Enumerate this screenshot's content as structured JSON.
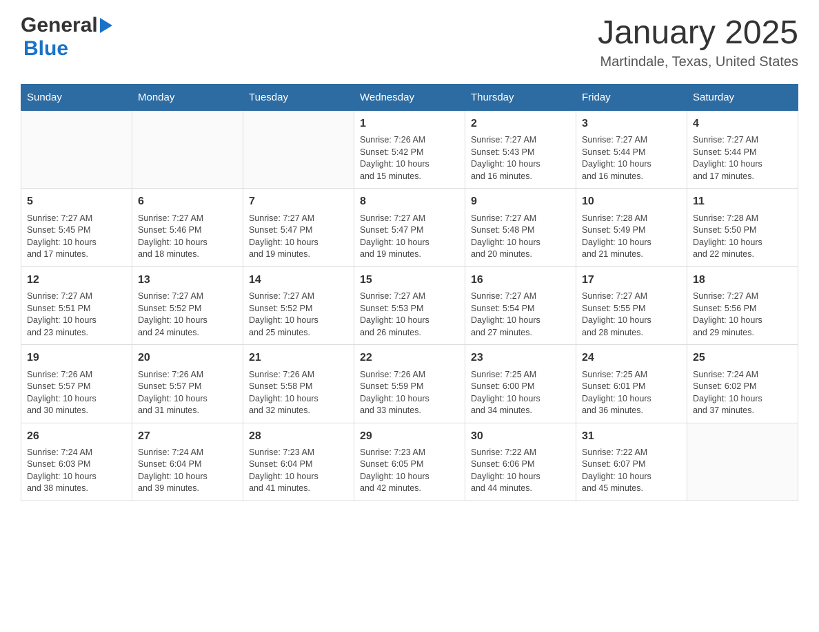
{
  "header": {
    "logo_general": "General",
    "logo_blue": "Blue",
    "title": "January 2025",
    "subtitle": "Martindale, Texas, United States"
  },
  "days_of_week": [
    "Sunday",
    "Monday",
    "Tuesday",
    "Wednesday",
    "Thursday",
    "Friday",
    "Saturday"
  ],
  "weeks": [
    [
      {
        "day": "",
        "info": ""
      },
      {
        "day": "",
        "info": ""
      },
      {
        "day": "",
        "info": ""
      },
      {
        "day": "1",
        "info": "Sunrise: 7:26 AM\nSunset: 5:42 PM\nDaylight: 10 hours\nand 15 minutes."
      },
      {
        "day": "2",
        "info": "Sunrise: 7:27 AM\nSunset: 5:43 PM\nDaylight: 10 hours\nand 16 minutes."
      },
      {
        "day": "3",
        "info": "Sunrise: 7:27 AM\nSunset: 5:44 PM\nDaylight: 10 hours\nand 16 minutes."
      },
      {
        "day": "4",
        "info": "Sunrise: 7:27 AM\nSunset: 5:44 PM\nDaylight: 10 hours\nand 17 minutes."
      }
    ],
    [
      {
        "day": "5",
        "info": "Sunrise: 7:27 AM\nSunset: 5:45 PM\nDaylight: 10 hours\nand 17 minutes."
      },
      {
        "day": "6",
        "info": "Sunrise: 7:27 AM\nSunset: 5:46 PM\nDaylight: 10 hours\nand 18 minutes."
      },
      {
        "day": "7",
        "info": "Sunrise: 7:27 AM\nSunset: 5:47 PM\nDaylight: 10 hours\nand 19 minutes."
      },
      {
        "day": "8",
        "info": "Sunrise: 7:27 AM\nSunset: 5:47 PM\nDaylight: 10 hours\nand 19 minutes."
      },
      {
        "day": "9",
        "info": "Sunrise: 7:27 AM\nSunset: 5:48 PM\nDaylight: 10 hours\nand 20 minutes."
      },
      {
        "day": "10",
        "info": "Sunrise: 7:28 AM\nSunset: 5:49 PM\nDaylight: 10 hours\nand 21 minutes."
      },
      {
        "day": "11",
        "info": "Sunrise: 7:28 AM\nSunset: 5:50 PM\nDaylight: 10 hours\nand 22 minutes."
      }
    ],
    [
      {
        "day": "12",
        "info": "Sunrise: 7:27 AM\nSunset: 5:51 PM\nDaylight: 10 hours\nand 23 minutes."
      },
      {
        "day": "13",
        "info": "Sunrise: 7:27 AM\nSunset: 5:52 PM\nDaylight: 10 hours\nand 24 minutes."
      },
      {
        "day": "14",
        "info": "Sunrise: 7:27 AM\nSunset: 5:52 PM\nDaylight: 10 hours\nand 25 minutes."
      },
      {
        "day": "15",
        "info": "Sunrise: 7:27 AM\nSunset: 5:53 PM\nDaylight: 10 hours\nand 26 minutes."
      },
      {
        "day": "16",
        "info": "Sunrise: 7:27 AM\nSunset: 5:54 PM\nDaylight: 10 hours\nand 27 minutes."
      },
      {
        "day": "17",
        "info": "Sunrise: 7:27 AM\nSunset: 5:55 PM\nDaylight: 10 hours\nand 28 minutes."
      },
      {
        "day": "18",
        "info": "Sunrise: 7:27 AM\nSunset: 5:56 PM\nDaylight: 10 hours\nand 29 minutes."
      }
    ],
    [
      {
        "day": "19",
        "info": "Sunrise: 7:26 AM\nSunset: 5:57 PM\nDaylight: 10 hours\nand 30 minutes."
      },
      {
        "day": "20",
        "info": "Sunrise: 7:26 AM\nSunset: 5:57 PM\nDaylight: 10 hours\nand 31 minutes."
      },
      {
        "day": "21",
        "info": "Sunrise: 7:26 AM\nSunset: 5:58 PM\nDaylight: 10 hours\nand 32 minutes."
      },
      {
        "day": "22",
        "info": "Sunrise: 7:26 AM\nSunset: 5:59 PM\nDaylight: 10 hours\nand 33 minutes."
      },
      {
        "day": "23",
        "info": "Sunrise: 7:25 AM\nSunset: 6:00 PM\nDaylight: 10 hours\nand 34 minutes."
      },
      {
        "day": "24",
        "info": "Sunrise: 7:25 AM\nSunset: 6:01 PM\nDaylight: 10 hours\nand 36 minutes."
      },
      {
        "day": "25",
        "info": "Sunrise: 7:24 AM\nSunset: 6:02 PM\nDaylight: 10 hours\nand 37 minutes."
      }
    ],
    [
      {
        "day": "26",
        "info": "Sunrise: 7:24 AM\nSunset: 6:03 PM\nDaylight: 10 hours\nand 38 minutes."
      },
      {
        "day": "27",
        "info": "Sunrise: 7:24 AM\nSunset: 6:04 PM\nDaylight: 10 hours\nand 39 minutes."
      },
      {
        "day": "28",
        "info": "Sunrise: 7:23 AM\nSunset: 6:04 PM\nDaylight: 10 hours\nand 41 minutes."
      },
      {
        "day": "29",
        "info": "Sunrise: 7:23 AM\nSunset: 6:05 PM\nDaylight: 10 hours\nand 42 minutes."
      },
      {
        "day": "30",
        "info": "Sunrise: 7:22 AM\nSunset: 6:06 PM\nDaylight: 10 hours\nand 44 minutes."
      },
      {
        "day": "31",
        "info": "Sunrise: 7:22 AM\nSunset: 6:07 PM\nDaylight: 10 hours\nand 45 minutes."
      },
      {
        "day": "",
        "info": ""
      }
    ]
  ]
}
